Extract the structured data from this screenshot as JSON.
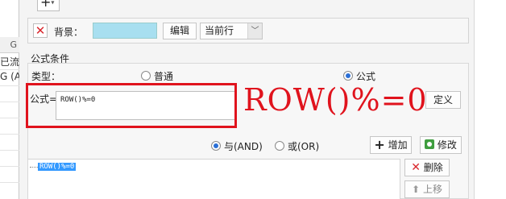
{
  "left_strip": {
    "header": "G",
    "row1": "已流",
    "row2": "G (A"
  },
  "top": {
    "add_label": "+"
  },
  "background": {
    "label": "背景：",
    "swatch_color": "#a8dff0",
    "edit_label": "编辑",
    "scope_value": "当前行"
  },
  "conditions": {
    "section_title": "公式条件",
    "type_label": "类型：",
    "type_normal": "普通",
    "type_formula": "公式",
    "formula_label": "公式=",
    "formula_value": "ROW()%=0",
    "annotation": "ROW()%=0",
    "define_label": "定义",
    "and_label": "与(AND)",
    "or_label": "或(OR)",
    "add_label": "增加",
    "modify_label": "修改",
    "list_items": [
      "ROW()%=0"
    ],
    "delete_label": "删除",
    "up_label": "上移"
  }
}
